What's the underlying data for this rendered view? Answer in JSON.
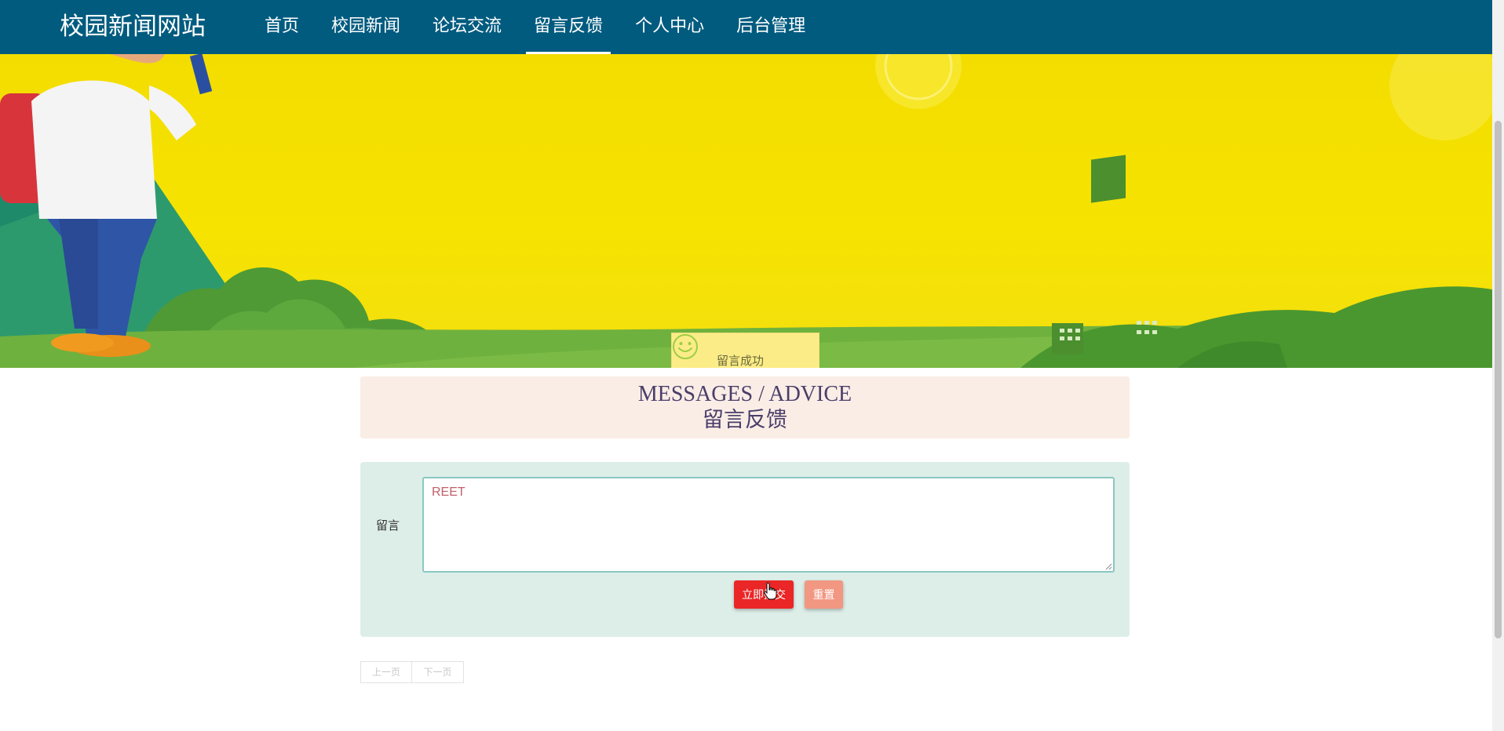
{
  "header": {
    "site_title": "校园新闻网站",
    "nav": [
      {
        "label": "首页",
        "active": false
      },
      {
        "label": "校园新闻",
        "active": false
      },
      {
        "label": "论坛交流",
        "active": false
      },
      {
        "label": "留言反馈",
        "active": true
      },
      {
        "label": "个人中心",
        "active": false
      },
      {
        "label": "后台管理",
        "active": false
      }
    ]
  },
  "banner": {
    "toast_text": "留言成功",
    "toast_icon": "smile-icon",
    "slide_count": 3,
    "active_slide": 2
  },
  "section": {
    "title_en": "MESSAGES / ADVICE",
    "title_cn": "留言反馈"
  },
  "form": {
    "label": "留言",
    "message_value": "REET",
    "submit_label": "立即提交",
    "reset_label": "重置"
  },
  "pager": {
    "prev_label": "上一页",
    "next_label": "下一页"
  },
  "colors": {
    "header_bg": "#015b7f",
    "submit_bg": "#ea2626",
    "reset_bg": "#f29782",
    "form_bg": "#ddeee8",
    "title_bg": "#faede6"
  }
}
